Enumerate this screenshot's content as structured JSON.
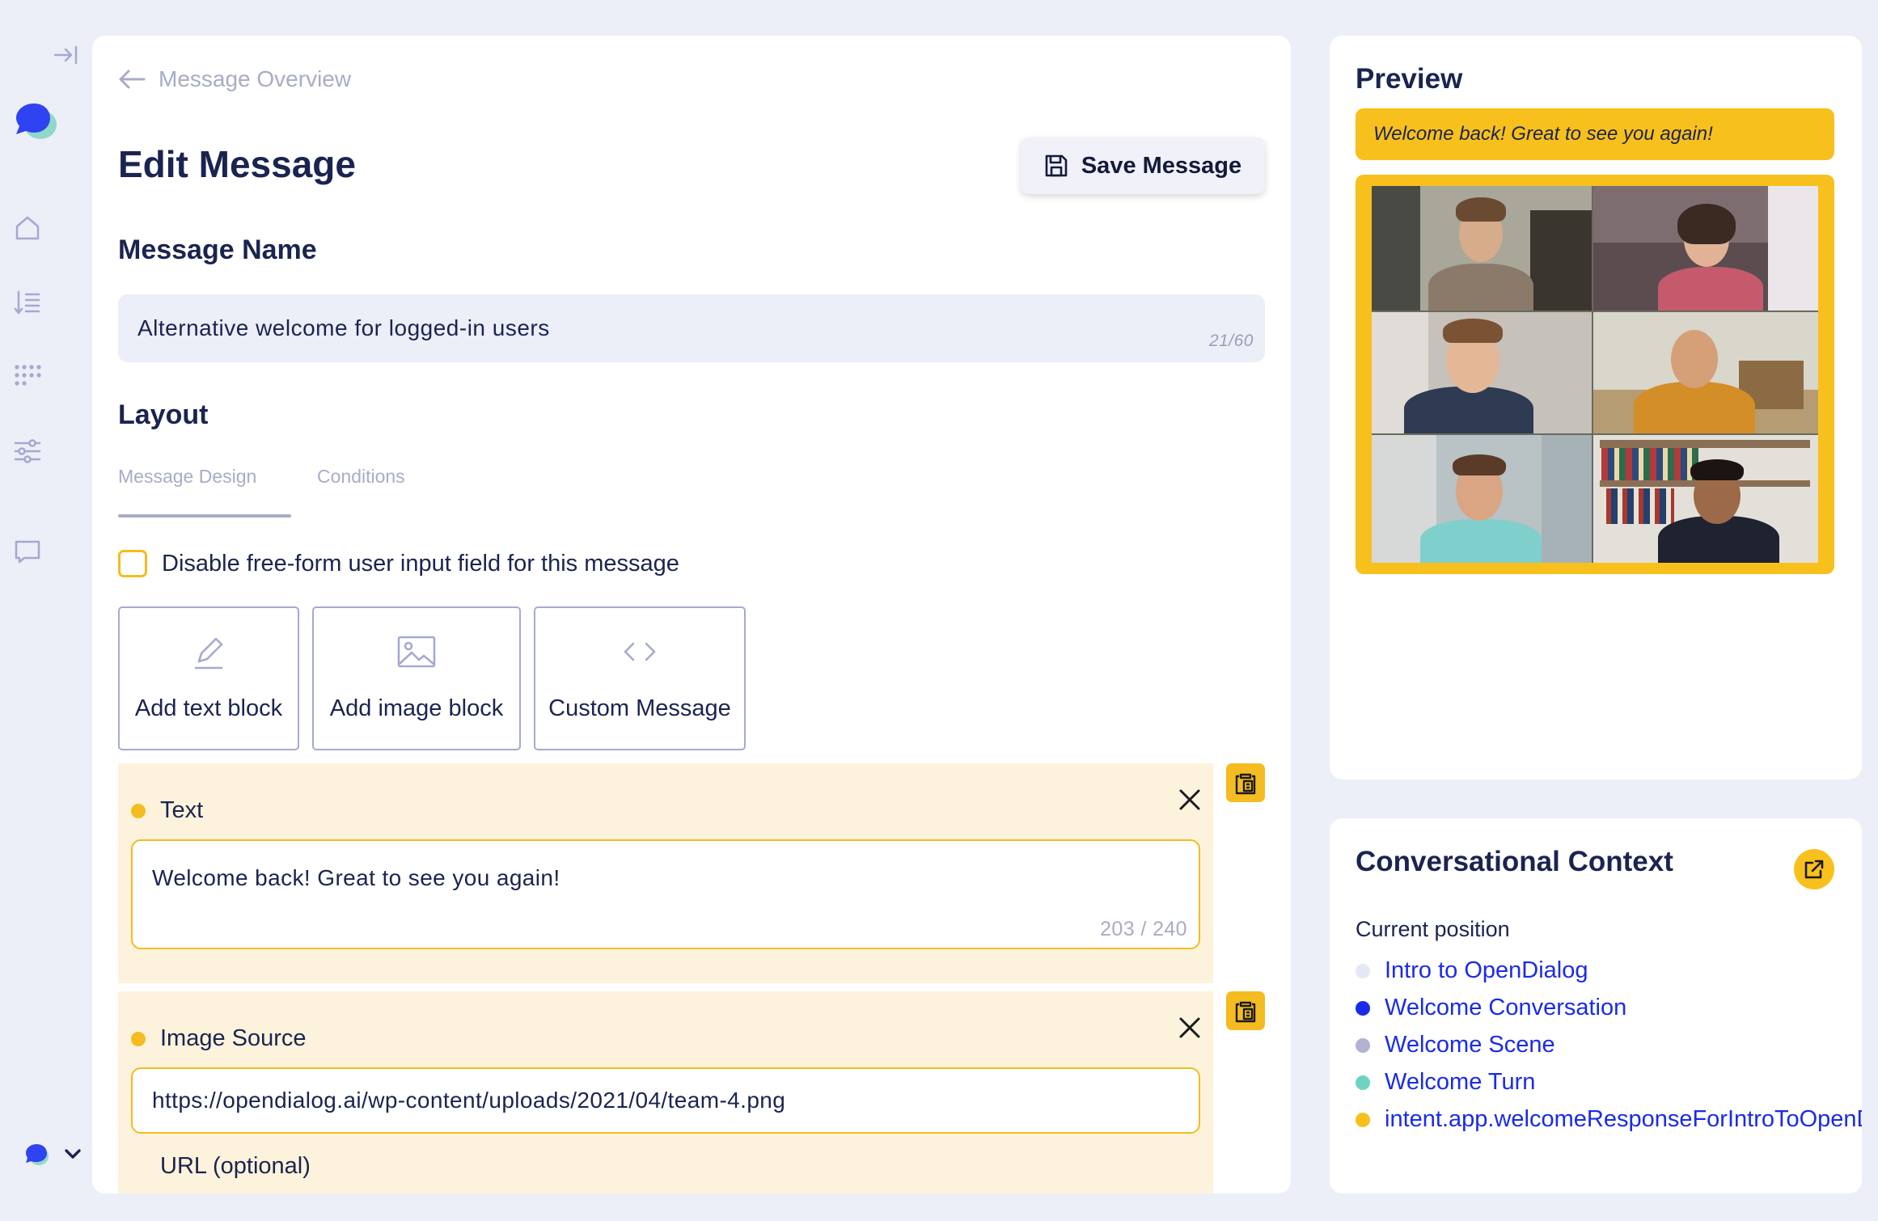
{
  "breadcrumb": {
    "back_label": "Message Overview"
  },
  "header": {
    "title": "Edit Message",
    "save_label": "Save Message"
  },
  "message_name": {
    "heading": "Message Name",
    "value": "Alternative welcome for logged-in users",
    "counter": "21/60"
  },
  "layout": {
    "heading": "Layout",
    "tabs": [
      {
        "label": "Message Design",
        "active": true
      },
      {
        "label": "Conditions",
        "active": false
      }
    ],
    "disable_input_label": "Disable free-form user input field for this message",
    "add_buttons": [
      {
        "label": "Add text block",
        "icon": "pencil-icon"
      },
      {
        "label": "Add image block",
        "icon": "image-icon"
      },
      {
        "label": "Custom Message",
        "icon": "code-icon"
      }
    ]
  },
  "blocks": [
    {
      "label": "Text",
      "value": "Welcome back! Great to see you again!",
      "counter": "203 / 240"
    },
    {
      "label": "Image Source",
      "value": "https://opendialog.ai/wp-content/uploads/2021/04/team-4.png",
      "next_label": "URL (optional)"
    }
  ],
  "preview": {
    "title": "Preview",
    "bubble_text": "Welcome back! Great to see you again!"
  },
  "context": {
    "title": "Conversational Context",
    "current_position_label": "Current position",
    "items": [
      {
        "label": "Intro to OpenDialog",
        "color": "#e6e7f4"
      },
      {
        "label": "Welcome Conversation",
        "color": "#1a2be8"
      },
      {
        "label": "Welcome Scene",
        "color": "#b2b2d2"
      },
      {
        "label": "Welcome Turn",
        "color": "#6fd3c2"
      },
      {
        "label": "intent.app.welcomeResponseForIntroToOpenDialog",
        "color": "#f8c01c"
      }
    ]
  },
  "colors": {
    "accent": "#f4bc21",
    "brand": "#2f43f2",
    "link": "#1a2be8",
    "background": "#eceef8"
  }
}
